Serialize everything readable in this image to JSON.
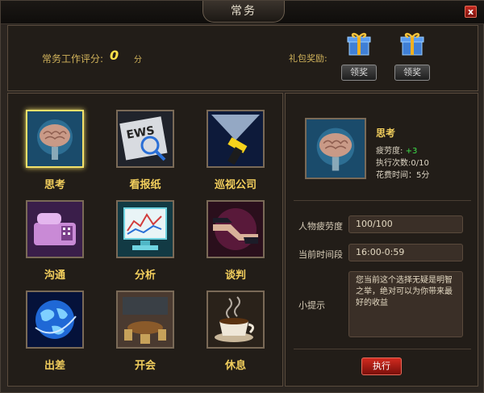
{
  "window": {
    "title": "常务",
    "close_label": "x"
  },
  "top": {
    "score_label": "常务工作评分:",
    "score_value": "0",
    "score_unit": "分",
    "gift_label": "礼包奖励:",
    "gifts": [
      {
        "icon": "gift-box-icon",
        "button": "领奖"
      },
      {
        "icon": "gift-box-icon",
        "button": "领奖"
      }
    ]
  },
  "actions": [
    {
      "label": "思考",
      "icon": "brain-icon",
      "selected": true
    },
    {
      "label": "看报纸",
      "icon": "newspaper-icon"
    },
    {
      "label": "巡视公司",
      "icon": "flashlight-icon"
    },
    {
      "label": "沟通",
      "icon": "fax-phone-icon"
    },
    {
      "label": "分析",
      "icon": "analysis-monitor-icon"
    },
    {
      "label": "谈判",
      "icon": "handshake-icon"
    },
    {
      "label": "出差",
      "icon": "globe-icon"
    },
    {
      "label": "开会",
      "icon": "meeting-room-icon"
    },
    {
      "label": "休息",
      "icon": "coffee-cup-icon"
    }
  ],
  "detail": {
    "name": "思考",
    "fatigue_label": "疲劳度:",
    "fatigue_value": "+3",
    "exec_count": "执行次数:0/10",
    "time_cost": "花费时间：5分",
    "person_fatigue_label": "人物疲劳度",
    "person_fatigue_value": "100/100",
    "period_label": "当前时间段",
    "period_value": "16:00-0:59",
    "tip_label": "小提示",
    "tip_text": "您当前这个选择无疑是明智之举，绝对可以为你带来最好的收益",
    "execute_label": "执行"
  },
  "colors": {
    "accent_gold": "#f3cf5d",
    "score_yellow": "#ffe14a",
    "green": "#3ee04a",
    "execute_red": "#c42a21"
  }
}
